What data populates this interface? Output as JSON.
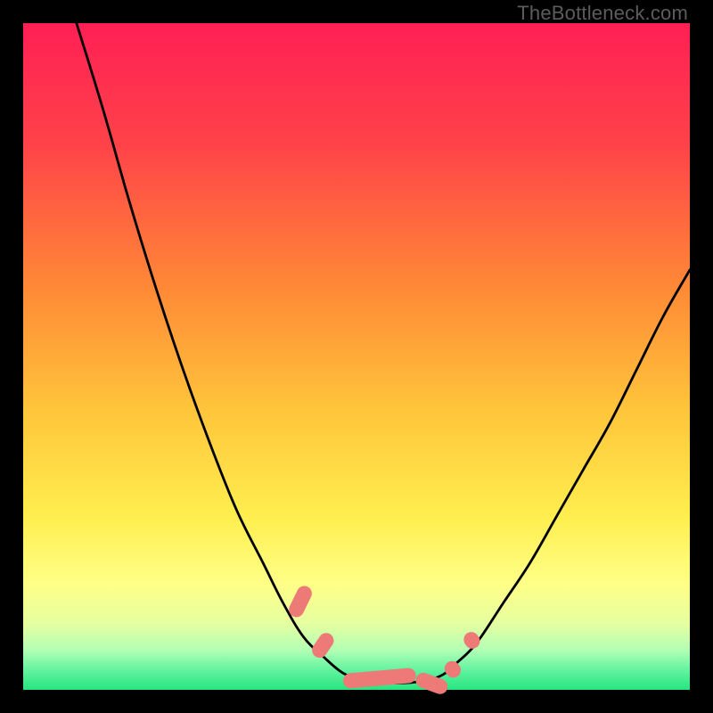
{
  "watermark": "TheBottleneck.com",
  "colors": {
    "frame_bg": "#000000",
    "curve": "#000000",
    "bumps": "#ee7a77",
    "green_band": "#27e57e",
    "watermark": "#5c5c5c"
  },
  "chart_data": {
    "type": "line",
    "title": "",
    "xlabel": "",
    "ylabel": "",
    "xlim": [
      0,
      100
    ],
    "ylim": [
      0,
      100
    ],
    "grid": false,
    "legend": false,
    "background_gradient_stops": [
      {
        "pct": 0,
        "color": "#ff1f55"
      },
      {
        "pct": 18,
        "color": "#ff4249"
      },
      {
        "pct": 40,
        "color": "#ff8a36"
      },
      {
        "pct": 58,
        "color": "#ffc53b"
      },
      {
        "pct": 74,
        "color": "#ffee4e"
      },
      {
        "pct": 84,
        "color": "#ffff86"
      },
      {
        "pct": 90,
        "color": "#e6ffa0"
      },
      {
        "pct": 94,
        "color": "#b4ffb4"
      },
      {
        "pct": 97,
        "color": "#63f3a1"
      },
      {
        "pct": 100,
        "color": "#27e57e"
      }
    ],
    "series": [
      {
        "name": "curve",
        "x": [
          8,
          12,
          16,
          20,
          24,
          28,
          32,
          36,
          39,
          42,
          45,
          48,
          51,
          55,
          60,
          63,
          65,
          68,
          72,
          76,
          80,
          84,
          88,
          92,
          96,
          100
        ],
        "y": [
          100,
          87,
          73,
          60,
          48,
          37,
          27,
          19,
          13,
          8,
          5,
          2.5,
          1.5,
          1,
          1.3,
          2.3,
          4,
          7,
          13,
          19,
          26,
          33,
          40,
          48,
          56,
          63
        ]
      }
    ],
    "bumps": [
      {
        "x": 40.5,
        "y": 11,
        "len": 5,
        "angle": -64,
        "w": 2.3
      },
      {
        "x": 43.8,
        "y": 5,
        "len": 4,
        "angle": -56,
        "w": 2.3
      },
      {
        "x": 48,
        "y": 1.3,
        "len": 11,
        "angle": -5,
        "w": 2.3
      },
      {
        "x": 59,
        "y": 1.8,
        "len": 5,
        "angle": 20,
        "w": 2.3
      },
      {
        "x": 63.7,
        "y": 4.1,
        "len": 2.6,
        "angle": 52,
        "w": 2.3
      },
      {
        "x": 66.6,
        "y": 8.5,
        "len": 2.6,
        "angle": 56,
        "w": 2.3
      }
    ]
  }
}
